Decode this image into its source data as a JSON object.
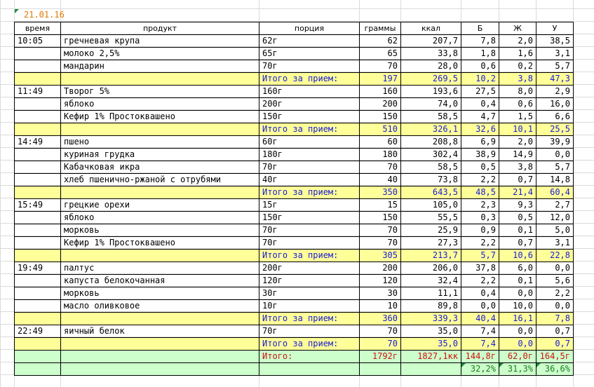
{
  "date": "21.01.16",
  "headers": [
    "время",
    "продукт",
    "порция",
    "граммы",
    "ккал",
    "Б",
    "Ж",
    "У"
  ],
  "rows": [
    {
      "type": "item",
      "time": "10:05",
      "product": "гречневая крупа",
      "portion": "62г",
      "grams": "62",
      "kcal": "207,7",
      "b": "7,8",
      "z": "2,0",
      "u": "38,5"
    },
    {
      "type": "item",
      "time": "",
      "product": "молоко 2,5%",
      "portion": "65г",
      "grams": "65",
      "kcal": "33,8",
      "b": "1,8",
      "z": "1,6",
      "u": "3,1"
    },
    {
      "type": "item",
      "time": "",
      "product": "мандарин",
      "portion": "70г",
      "grams": "70",
      "kcal": "28,0",
      "b": "0,6",
      "z": "0,2",
      "u": "5,7"
    },
    {
      "type": "subtotal",
      "time": "",
      "product": "",
      "portion": "Итого за прием:",
      "grams": "197",
      "kcal": "269,5",
      "b": "10,2",
      "z": "3,8",
      "u": "47,3"
    },
    {
      "type": "item",
      "time": "11:49",
      "product": "Творог 5%",
      "portion": "160г",
      "grams": "160",
      "kcal": "193,6",
      "b": "27,5",
      "z": "8,0",
      "u": "2,9"
    },
    {
      "type": "item",
      "time": "",
      "product": "яблоко",
      "portion": "200г",
      "grams": "200",
      "kcal": "74,0",
      "b": "0,4",
      "z": "0,6",
      "u": "16,0"
    },
    {
      "type": "item",
      "time": "",
      "product": "Кефир 1% Простоквашено",
      "portion": "150г",
      "grams": "150",
      "kcal": "58,5",
      "b": "4,7",
      "z": "1,5",
      "u": "6,6"
    },
    {
      "type": "subtotal",
      "time": "",
      "product": "",
      "portion": "Итого за прием:",
      "grams": "510",
      "kcal": "326,1",
      "b": "32,6",
      "z": "10,1",
      "u": "25,5"
    },
    {
      "type": "item",
      "time": "14:49",
      "product": "пшено",
      "portion": "60г",
      "grams": "60",
      "kcal": "208,8",
      "b": "6,9",
      "z": "2,0",
      "u": "39,9"
    },
    {
      "type": "item",
      "time": "",
      "product": "куриная грудка",
      "portion": "180г",
      "grams": "180",
      "kcal": "302,4",
      "b": "38,9",
      "z": "14,9",
      "u": "0,0"
    },
    {
      "type": "item",
      "time": "",
      "product": "Кабачковая икра",
      "portion": "70г",
      "grams": "70",
      "kcal": "58,5",
      "b": "0,5",
      "z": "3,8",
      "u": "5,7"
    },
    {
      "type": "item",
      "time": "",
      "product": "хлеб пшенично-ржаной с отрубями",
      "portion": "40г",
      "grams": "40",
      "kcal": "73,8",
      "b": "2,2",
      "z": "0,7",
      "u": "14,8"
    },
    {
      "type": "subtotal",
      "time": "",
      "product": "",
      "portion": "Итого за прием:",
      "grams": "350",
      "kcal": "643,5",
      "b": "48,5",
      "z": "21,4",
      "u": "60,4"
    },
    {
      "type": "item",
      "time": "15:49",
      "product": "грецкие орехи",
      "portion": "15г",
      "grams": "15",
      "kcal": "105,0",
      "b": "2,3",
      "z": "9,3",
      "u": "2,7"
    },
    {
      "type": "item",
      "time": "",
      "product": "яблоко",
      "portion": "150г",
      "grams": "150",
      "kcal": "55,5",
      "b": "0,3",
      "z": "0,5",
      "u": "12,0"
    },
    {
      "type": "item",
      "time": "",
      "product": "морковь",
      "portion": "70г",
      "grams": "70",
      "kcal": "25,9",
      "b": "0,9",
      "z": "0,1",
      "u": "5,0"
    },
    {
      "type": "item",
      "time": "",
      "product": "Кефир 1% Простоквашено",
      "portion": "70г",
      "grams": "70",
      "kcal": "27,3",
      "b": "2,2",
      "z": "0,7",
      "u": "3,1"
    },
    {
      "type": "subtotal",
      "time": "",
      "product": "",
      "portion": "Итого за прием:",
      "grams": "305",
      "kcal": "213,7",
      "b": "5,7",
      "z": "10,6",
      "u": "22,8"
    },
    {
      "type": "item",
      "time": "19:49",
      "product": "палтус",
      "portion": "200г",
      "grams": "200",
      "kcal": "206,0",
      "b": "37,8",
      "z": "6,0",
      "u": "0,0"
    },
    {
      "type": "item",
      "time": "",
      "product": "капуста белокочанная",
      "portion": "120г",
      "grams": "120",
      "kcal": "32,4",
      "b": "2,2",
      "z": "0,1",
      "u": "5,6"
    },
    {
      "type": "item",
      "time": "",
      "product": "морковь",
      "portion": "30г",
      "grams": "30",
      "kcal": "11,1",
      "b": "0,4",
      "z": "0,0",
      "u": "2,2"
    },
    {
      "type": "item",
      "time": "",
      "product": "масло оливковое",
      "portion": "10г",
      "grams": "10",
      "kcal": "89,8",
      "b": "0,0",
      "z": "10,0",
      "u": "0,0"
    },
    {
      "type": "subtotal",
      "time": "",
      "product": "",
      "portion": "Итого за прием:",
      "grams": "360",
      "kcal": "339,3",
      "b": "40,4",
      "z": "16,1",
      "u": "7,8"
    },
    {
      "type": "item",
      "time": "22:49",
      "product": "яичный белок",
      "portion": "70г",
      "grams": "70",
      "kcal": "35,0",
      "b": "7,4",
      "z": "0,0",
      "u": "0,7"
    },
    {
      "type": "subtotal",
      "time": "",
      "product": "",
      "portion": "Итого за прием:",
      "grams": "70",
      "kcal": "35,0",
      "b": "7,4",
      "z": "0,0",
      "u": "0,7"
    }
  ],
  "total": {
    "label": "Итого:",
    "grams": "1792г",
    "kcal": "1827,1кк",
    "b": "144,8г",
    "z": "62,0г",
    "u": "164,5г"
  },
  "percent": {
    "b": "32,2%",
    "z": "31,3%",
    "u": "36,6%"
  }
}
